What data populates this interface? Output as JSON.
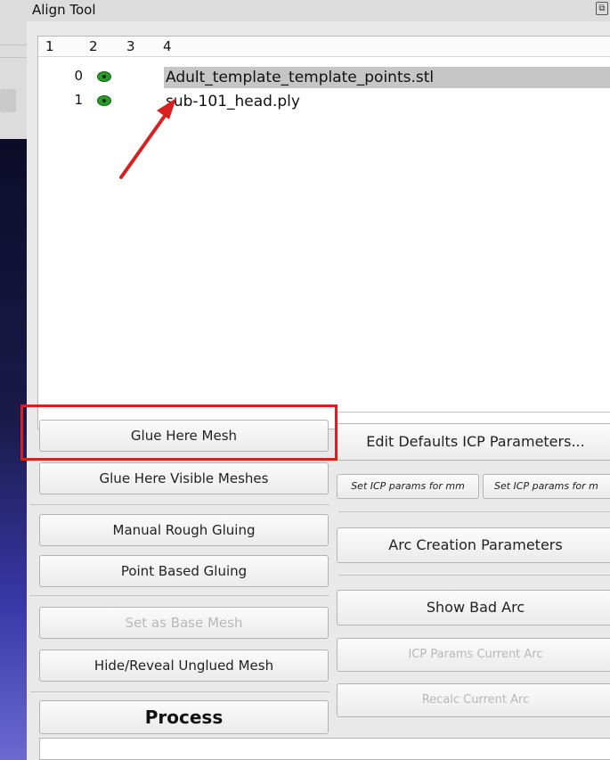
{
  "window": {
    "title": "Align Tool"
  },
  "tree": {
    "columns": [
      "1",
      "2",
      "3",
      "4"
    ],
    "rows": [
      {
        "index": "0",
        "name": "Adult_template_template_points.stl",
        "visible_icon": "eye-icon"
      },
      {
        "index": "1",
        "name": "sub-101_head.ply",
        "visible_icon": "eye-icon"
      }
    ]
  },
  "left_buttons": {
    "glue_here_mesh": "Glue Here Mesh",
    "glue_here_visible_meshes": "Glue Here Visible Meshes",
    "manual_rough_gluing": "Manual Rough Gluing",
    "point_based_gluing": "Point Based Gluing",
    "set_as_base_mesh": "Set as Base Mesh",
    "hide_reveal_unglued_mesh": "Hide/Reveal Unglued Mesh",
    "process": "Process"
  },
  "right_buttons": {
    "edit_defaults_icp": "Edit Defaults ICP Parameters...",
    "set_icp_mm": "Set ICP params for mm",
    "set_icp_m": "Set ICP params for m",
    "arc_creation_parameters": "Arc Creation Parameters",
    "show_bad_arc": "Show Bad Arc",
    "icp_params_current_arc": "ICP Params Current Arc",
    "recalc_current_arc": "Recalc Current Arc"
  },
  "colors": {
    "annotation": "#d92020",
    "selected_row": "#c6c6c6",
    "visible_icon": "#2a9a2a"
  }
}
